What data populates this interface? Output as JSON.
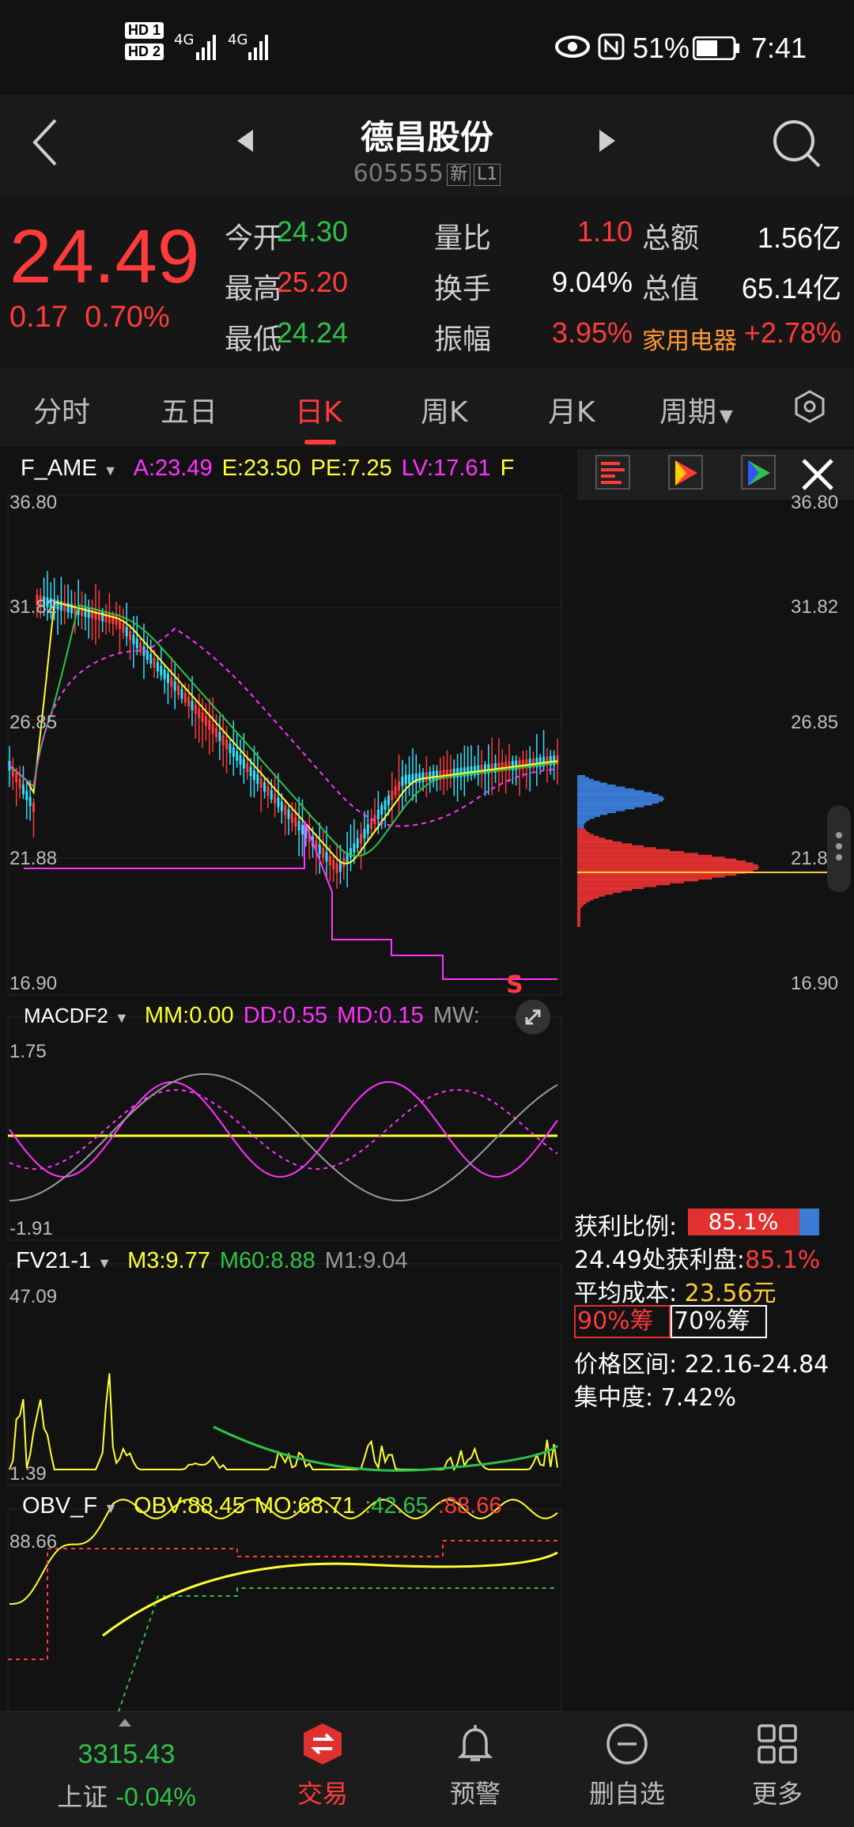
{
  "status_bar": {
    "hd1": "HD 1",
    "hd2": "HD 2",
    "net1": "4G",
    "net2": "4G",
    "battery": "51%",
    "time": "7:41"
  },
  "header": {
    "title": "德昌股份",
    "code": "605555",
    "tag_new": "新",
    "tag_level": "L1"
  },
  "quote": {
    "price": "24.49",
    "change": "0.17",
    "change_pct": "0.70%",
    "rows": [
      [
        {
          "label": "今开",
          "value": "24.30",
          "color": "#2ec24a"
        },
        {
          "label": "量比",
          "value": "1.10",
          "color": "#ff3b3b"
        },
        {
          "label": "总额",
          "value": "1.56亿",
          "color": "#ffffff"
        }
      ],
      [
        {
          "label": "最高",
          "value": "25.20",
          "color": "#ff3b3b"
        },
        {
          "label": "换手",
          "value": "9.04%",
          "color": "#ffffff"
        },
        {
          "label": "总值",
          "value": "65.14亿",
          "color": "#ffffff"
        }
      ],
      [
        {
          "label": "最低",
          "value": "24.24",
          "color": "#2ec24a"
        },
        {
          "label": "振幅",
          "value": "3.95%",
          "color": "#ff3b3b"
        },
        {
          "label": "家用电器",
          "value": "+2.78%",
          "color": "#ff3b3b"
        }
      ]
    ]
  },
  "tabs": [
    "分时",
    "五日",
    "日K",
    "周K",
    "月K",
    "周期"
  ],
  "active_tab": "日K",
  "main_chart": {
    "indicator": "F_AME",
    "params": [
      {
        "k": "A:",
        "v": "23.49",
        "color": "#ff33ff"
      },
      {
        "k": "E:",
        "v": "23.50",
        "color": "#ffff33"
      },
      {
        "k": "PE:",
        "v": "7.25",
        "color": "#ffff33"
      },
      {
        "k": "LV:",
        "v": "17.61",
        "color": "#ff33ff"
      },
      {
        "k": "F",
        "v": "",
        "color": "#ffff33"
      }
    ],
    "y_ticks": [
      "36.80",
      "31.82",
      "26.85",
      "21.88",
      "16.90"
    ],
    "signal": "S"
  },
  "macd": {
    "indicator": "MACDF2",
    "params": [
      {
        "k": "MM:",
        "v": "0.00",
        "color": "#ffff33"
      },
      {
        "k": "DD:",
        "v": "0.55",
        "color": "#ff33ff"
      },
      {
        "k": "MD:",
        "v": "0.15",
        "color": "#ff33ff"
      },
      {
        "k": "MW:",
        "v": "",
        "color": "#9a9a9a"
      }
    ],
    "y_ticks": [
      "1.75",
      "-1.91"
    ]
  },
  "fv": {
    "indicator": "FV21-1",
    "params": [
      {
        "k": "M3:",
        "v": "9.77",
        "color": "#ffff33"
      },
      {
        "k": "M60:",
        "v": "8.88",
        "color": "#2ec24a"
      },
      {
        "k": "M1:",
        "v": "9.04",
        "color": "#9a9a9a"
      }
    ],
    "y_ticks": [
      "47.09",
      "1.39"
    ]
  },
  "obv": {
    "indicator": "OBV_F",
    "params": [
      {
        "k": "OBV:",
        "v": "88.45",
        "color": "#ffff33"
      },
      {
        "k": "MO:",
        "v": "68.71",
        "color": "#ffff33"
      },
      {
        "k": ":",
        "v": "42.65",
        "color": "#2ec24a"
      },
      {
        "k": ":",
        "v": "88.66",
        "color": "#ff3b3b"
      }
    ],
    "y_ticks": [
      "88.66"
    ]
  },
  "chip_panel": {
    "profit_ratio_label": "获利比例:",
    "profit_ratio": "85.1%",
    "profit_at_label": "24.49处获利盘:",
    "profit_at": "85.1%",
    "avg_cost_label": "平均成本:",
    "avg_cost": "23.56元",
    "btn90": "90%筹",
    "btn70": "70%筹",
    "range_label": "价格区间:",
    "range": "22.16-24.84",
    "concentration_label": "集中度:",
    "concentration": "7.42%",
    "y_ticks": [
      "36.80",
      "31.82",
      "26.85",
      "21.88",
      "16.90"
    ]
  },
  "bottom_nav": {
    "index_value": "3315.43",
    "index_name": "上证",
    "index_change": "-0.04%",
    "items": [
      "交易",
      "预警",
      "删自选",
      "更多"
    ]
  },
  "colors": {
    "up": "#ff3b3b",
    "down": "#2ec24a",
    "yellow": "#ffff33",
    "magenta": "#ff33ff",
    "cyan": "#33e0ff"
  }
}
